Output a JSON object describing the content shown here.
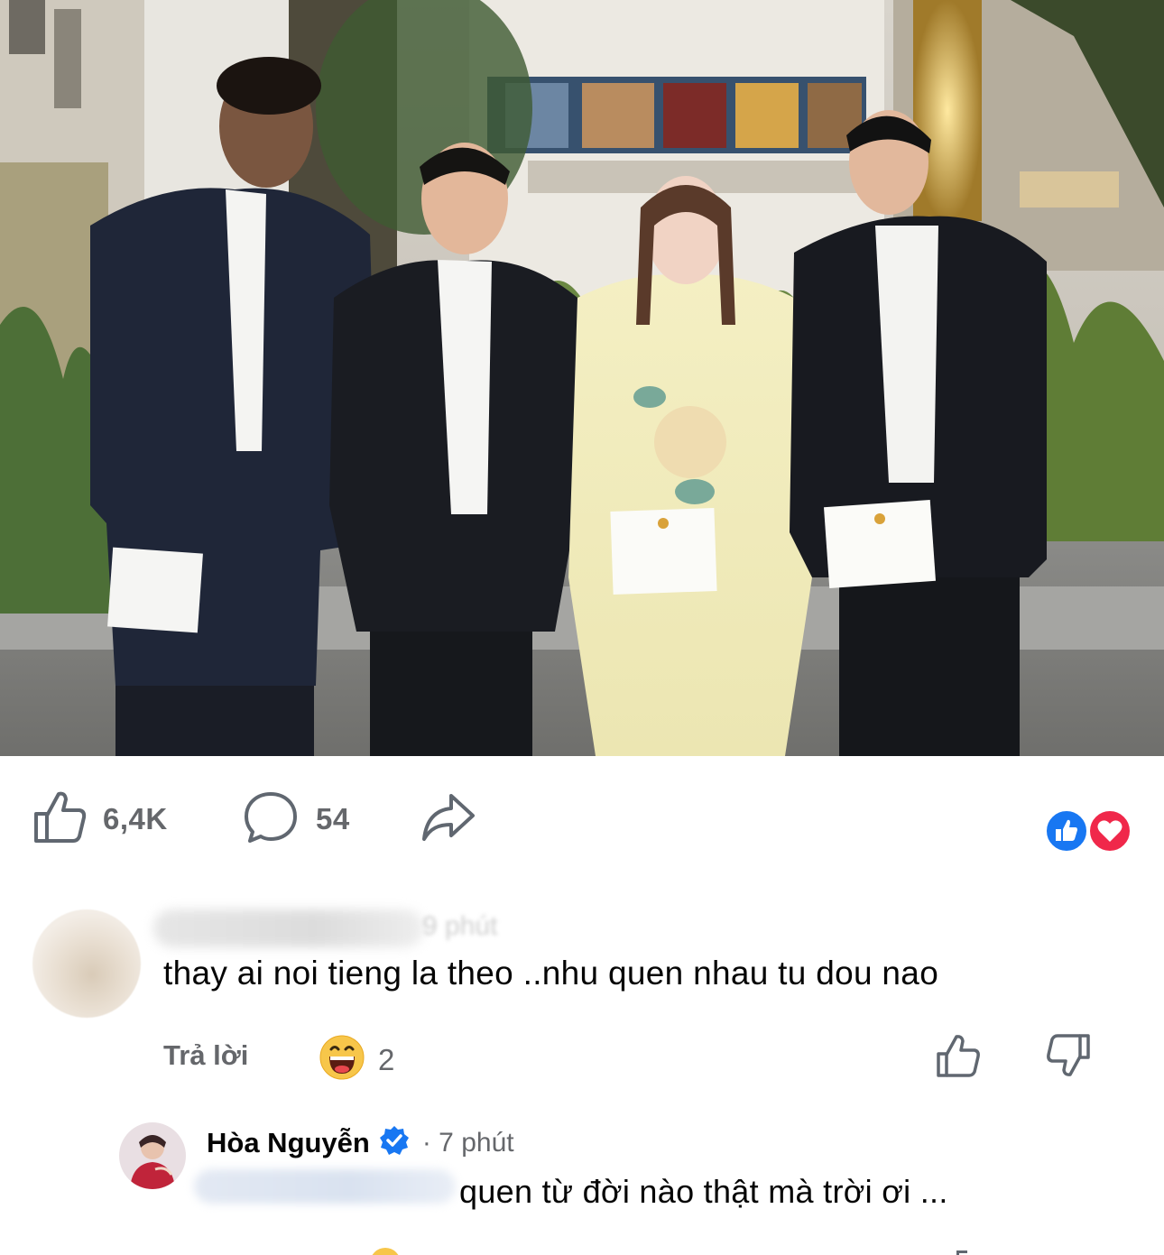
{
  "post": {
    "photo_icon": "wedding-group-photo"
  },
  "actions": {
    "like_count": "6,4K",
    "comment_count": "54",
    "like_icon": "thumbs-up-icon",
    "comment_icon": "comment-bubble-icon",
    "share_icon": "share-arrow-icon",
    "reactions": [
      "like-reaction-icon",
      "love-reaction-icon"
    ],
    "colors": {
      "like": "#1877f2",
      "love": "#f0284a",
      "muted": "#65676b"
    }
  },
  "comments": [
    {
      "time_blurred": "9 phút",
      "text": "thay ai noi tieng la theo ..nhu quen nhau tu dou nao",
      "reply_label": "Trả lời",
      "reaction_emoji": "grinning-face-icon",
      "reaction_count": "2"
    }
  ],
  "reply": {
    "name": "Hòa Nguyễn",
    "time": "· 7 phút",
    "text": "quen từ đời nào thật mà trời ơi ...",
    "verified_color": "#1877f2"
  }
}
